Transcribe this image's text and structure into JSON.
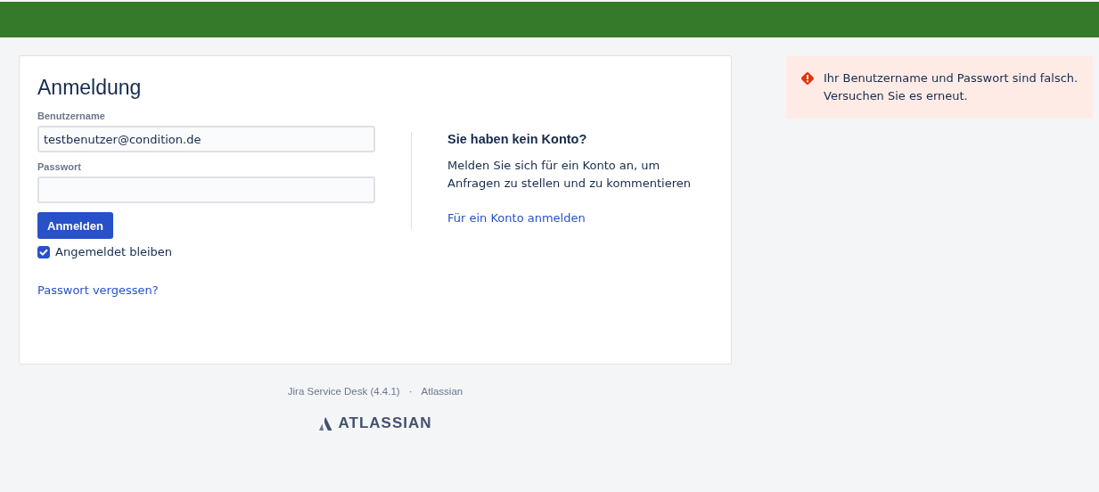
{
  "login": {
    "title": "Anmeldung",
    "username": {
      "label": "Benutzername",
      "value": "testbenutzer@condition.de"
    },
    "password": {
      "label": "Passwort"
    },
    "submit": "Anmelden",
    "remember": {
      "label": "Angemeldet bleiben",
      "checked": true
    },
    "forgot": "Passwort vergessen?"
  },
  "signup": {
    "heading": "Sie haben kein Konto?",
    "text": "Melden Sie sich für ein Konto an, um Anfragen zu stellen und zu kommentieren",
    "link": "Für ein Konto anmelden"
  },
  "error": {
    "message": "Ihr Benutzername und Passwort sind falsch. Versuchen Sie es erneut."
  },
  "footer": {
    "product": "Jira Service Desk (4.4.1)",
    "separator": "·",
    "vendor": "Atlassian",
    "logo": "ATLASSIAN"
  }
}
